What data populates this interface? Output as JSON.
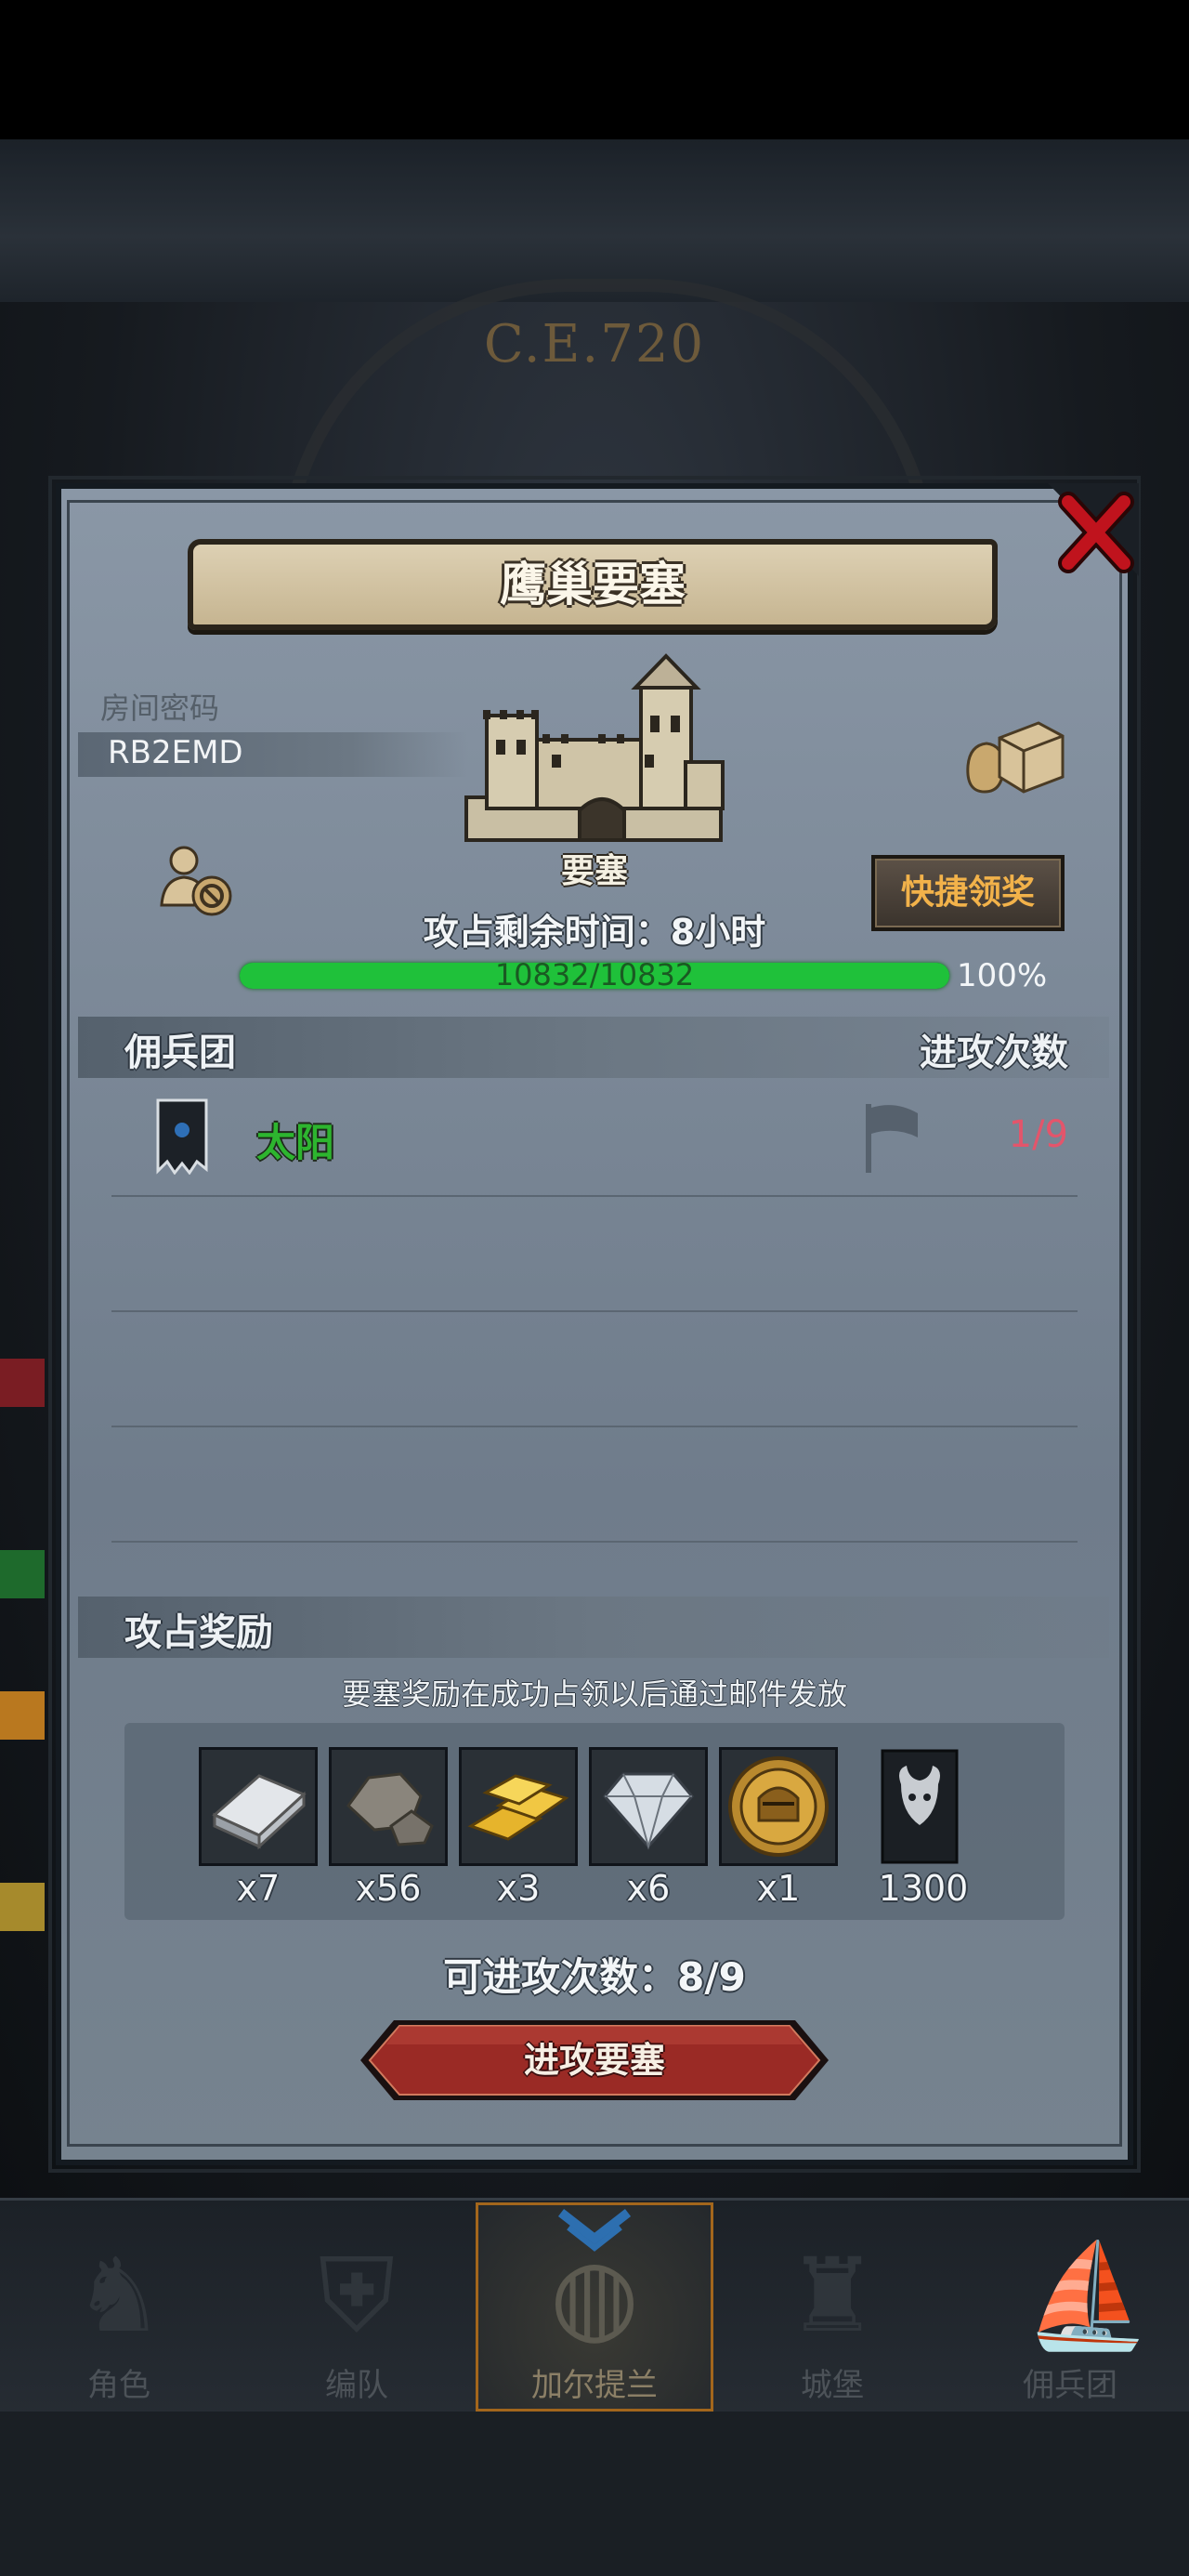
{
  "background": {
    "era": "C.E.720"
  },
  "dialog": {
    "title": "鹰巢要塞",
    "room_password_label": "房间密码",
    "room_password": "RB2EMD",
    "fortress_label": "要塞",
    "quick_claim": "快捷领奖",
    "timer": "攻占剩余时间：8小时",
    "hp": {
      "text": "10832/10832",
      "percent_label": "100%",
      "fraction": 1.0
    },
    "mercenary_header": "佣兵团",
    "attack_count_header": "进攻次数",
    "teams": [
      {
        "name": "太阳",
        "attacks": "1/9"
      }
    ],
    "rewards_header": "攻占奖励",
    "rewards_note": "要塞奖励在成功占领以后通过邮件发放",
    "rewards": [
      {
        "icon": "silver-ingot-icon",
        "count": "x7"
      },
      {
        "icon": "stone-ore-icon",
        "count": "x56"
      },
      {
        "icon": "gold-bars-icon",
        "count": "x3"
      },
      {
        "icon": "diamond-icon",
        "count": "x6"
      },
      {
        "icon": "knight-medal-icon",
        "count": "x1"
      },
      {
        "icon": "bull-banner-icon",
        "count": "1300"
      }
    ],
    "available_attacks": "可进攻次数：8/9",
    "attack_button": "进攻要塞"
  },
  "bottom_nav": [
    {
      "label": "角色",
      "icon": "knight-icon",
      "active": false
    },
    {
      "label": "编队",
      "icon": "helmet-icon",
      "active": false
    },
    {
      "label": "加尔提兰",
      "icon": "globe-icon",
      "active": true
    },
    {
      "label": "城堡",
      "icon": "castle-icon",
      "active": false
    },
    {
      "label": "佣兵团",
      "icon": "ship-icon",
      "active": false
    }
  ],
  "colors": {
    "team_green": "#2db52f",
    "attack_count_red": "#e3556b",
    "hp_green": "#1fc13a",
    "quick_claim_gold": "#f2b24a",
    "attack_button_red": "#9a2a25"
  }
}
